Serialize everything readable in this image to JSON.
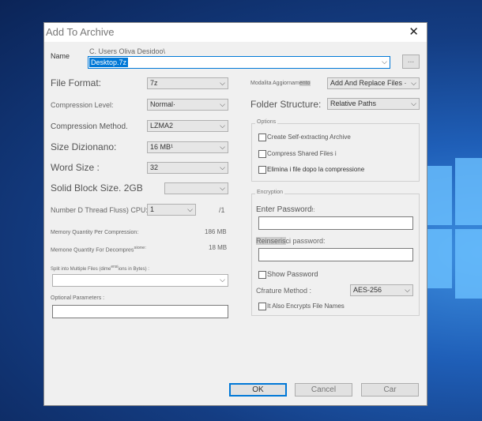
{
  "dialog": {
    "title": "Add To Archive",
    "close_glyph": "✕",
    "name_label": "Name",
    "path_prefix": "C. Users Oliva Desidoo\\",
    "archive_name": "Desktop.7z",
    "browse_label": "...",
    "left": {
      "format_label": "File Format:",
      "format_value": "7z",
      "level_label": "Compression Level:",
      "level_value": "Normal·",
      "method_label": "Compression Method.",
      "method_value": "LZMA2",
      "dict_label": "Size Dizionano:",
      "dict_value": "16 MB¹",
      "word_label": "Word Size :",
      "word_value": "32",
      "solid_label": "Solid Block Size. 2GB",
      "threads_label": "Number D Thread Fluss) CPU:",
      "threads_value": "1",
      "threads_max": "/1",
      "mem_comp_label": "Memory Quantity Per Compression:",
      "mem_comp_value": "186 MB",
      "mem_decomp_label": "Memone Quantity For Decompres",
      "mem_decomp_label2": "sione:",
      "mem_decomp_value": "18 MB",
      "split_label": "Split into Multiple Files (dime",
      "split_label2": "ensi",
      "split_label3": "ions in Bytes) :",
      "params_label": "Optional Parameters :"
    },
    "right": {
      "update_label": "Modalita Aggiornam",
      "update_label2": "ento",
      "update_value": "Add And Replace Files ·",
      "folder_label": "Folder Structure:",
      "folder_value": "Relative Paths",
      "options_title": "Options",
      "opt_sfx": "Create Self-extracting Archive",
      "opt_shared": "Compress Shared Files",
      "opt_shared_suffix": "i",
      "opt_delete": "Elimina i file dopo la compressione",
      "enc_title": "Encryption",
      "pwd_label": "Enter Password",
      "pwd_label_suffix": "!:",
      "repwd_label": "Reinseris",
      "repwd_label2": "ci password:",
      "show_pwd": "Show Password",
      "method_label": "Cfrature Method :",
      "method_value": "AES-256",
      "encrypt_names": "It Also Encrypts File Names"
    },
    "buttons": {
      "ok": "OK",
      "cancel": "Cancel",
      "car": "Car"
    }
  },
  "icons": [
    "close-icon",
    "dropdown-arrow-icon",
    "windows-logo-icon"
  ]
}
